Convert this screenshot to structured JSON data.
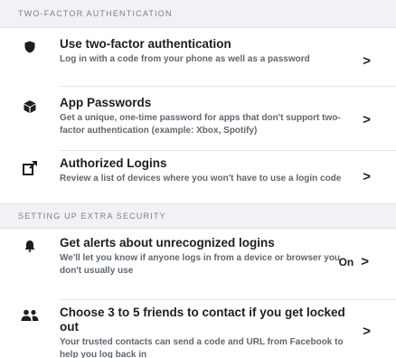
{
  "sections": {
    "two_factor": {
      "header": "TWO-FACTOR AUTHENTICATION",
      "items": [
        {
          "title": "Use two-factor authentication",
          "description": "Log in with a code from your phone as well as a password",
          "icon": "shield-icon",
          "chevron": ">"
        },
        {
          "title": "App Passwords",
          "description": "Get a unique, one-time password for apps that don't support two-factor authentication (example: Xbox, Spotify)",
          "icon": "cube-icon",
          "chevron": ">"
        },
        {
          "title": "Authorized Logins",
          "description": "Review a list of devices where you won't have to use a login code",
          "icon": "authorized-device-icon",
          "chevron": ">"
        }
      ]
    },
    "extra_security": {
      "header": "SETTING UP EXTRA SECURITY",
      "items": [
        {
          "title": "Get alerts about unrecognized logins",
          "description": "We'll let you know if anyone logs in from a device or browser you don't usually use",
          "icon": "bell-icon",
          "status": "On",
          "chevron": ">"
        },
        {
          "title": "Choose 3 to 5 friends to contact if you get locked out",
          "description": "Your trusted contacts can send a code and URL from Facebook to help you log back in",
          "icon": "friends-icon",
          "chevron": ">"
        }
      ]
    }
  }
}
